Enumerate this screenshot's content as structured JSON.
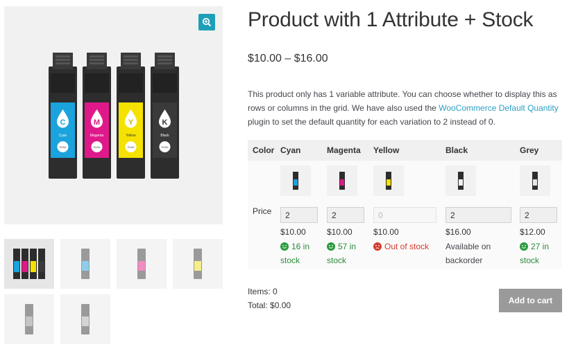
{
  "product": {
    "title": "Product with 1 Attribute + Stock",
    "price_range": "$10.00 – $16.00",
    "description_before_link": "This product only has 1 variable attribute. You can choose whether to display this as rows or columns in the grid. We have also used the ",
    "description_link": "WooCommerce Default Quantity",
    "description_after_link": " plugin to set the default quantity for each variation to 2 instead of 0."
  },
  "gallery": {
    "zoom_icon": "magnifier-plus-icon",
    "main_image_labels": [
      "C",
      "M",
      "Y",
      "K"
    ],
    "main_image_names": [
      "Cyan",
      "Magenta",
      "Yellow",
      "Black"
    ],
    "main_image_push": "PUSH",
    "thumbnails": [
      "all-cartridges",
      "cyan-cartridge",
      "magenta-cartridge",
      "yellow-cartridge",
      "black-cartridge",
      "grey-cartridge"
    ]
  },
  "grid": {
    "row_label_color": "Color",
    "row_label_price": "Price",
    "columns": [
      {
        "name": "Cyan",
        "qty": "2",
        "price": "$10.00",
        "stock": "16 in stock",
        "stock_status": "in"
      },
      {
        "name": "Magenta",
        "qty": "2",
        "price": "$10.00",
        "stock": "57 in stock",
        "stock_status": "in"
      },
      {
        "name": "Yellow",
        "qty": "0",
        "price": "$10.00",
        "stock": "Out of stock",
        "stock_status": "out"
      },
      {
        "name": "Black",
        "qty": "2",
        "price": "$16.00",
        "stock": "Available on backorder",
        "stock_status": "backorder"
      },
      {
        "name": "Grey",
        "qty": "2",
        "price": "$12.00",
        "stock": "27 in stock",
        "stock_status": "in"
      }
    ]
  },
  "cart": {
    "items": "Items: 0",
    "total": "Total: $0.00",
    "button_label": "Add to cart"
  },
  "colors": {
    "cyan": "#1aa3dc",
    "magenta": "#e0198a",
    "yellow": "#f5e200",
    "black": "#2e2e2e",
    "grey": "#7a7a7a",
    "accent_link": "#2c9fc4",
    "in_stock": "#2a8a3a",
    "out_of_stock": "#d33a2c",
    "button": "#9a9a9a"
  }
}
